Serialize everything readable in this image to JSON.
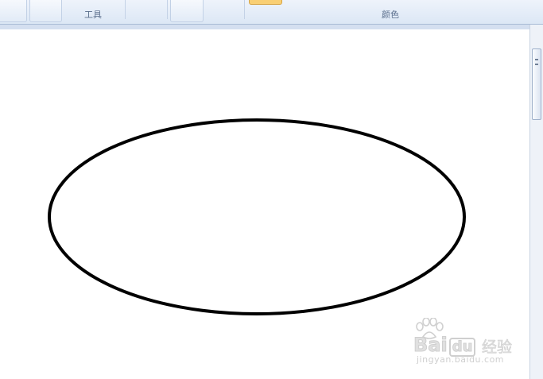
{
  "ribbon": {
    "groups": {
      "tools_label": "工具",
      "colors_label": "颜色"
    }
  },
  "canvas": {
    "shape": "ellipse",
    "stroke_color": "#000000",
    "fill_color": "#ffffff"
  },
  "watermark": {
    "brand_text": "Bai",
    "brand_text_2": "du",
    "product_text": "经验",
    "url_text": "jingyan.baidu.com",
    "icon": "paw-icon"
  },
  "colors": {
    "ribbon_bg": "#dce7f5",
    "swatch_selected": "#f9cf74",
    "canvas_bg": "#ffffff"
  }
}
